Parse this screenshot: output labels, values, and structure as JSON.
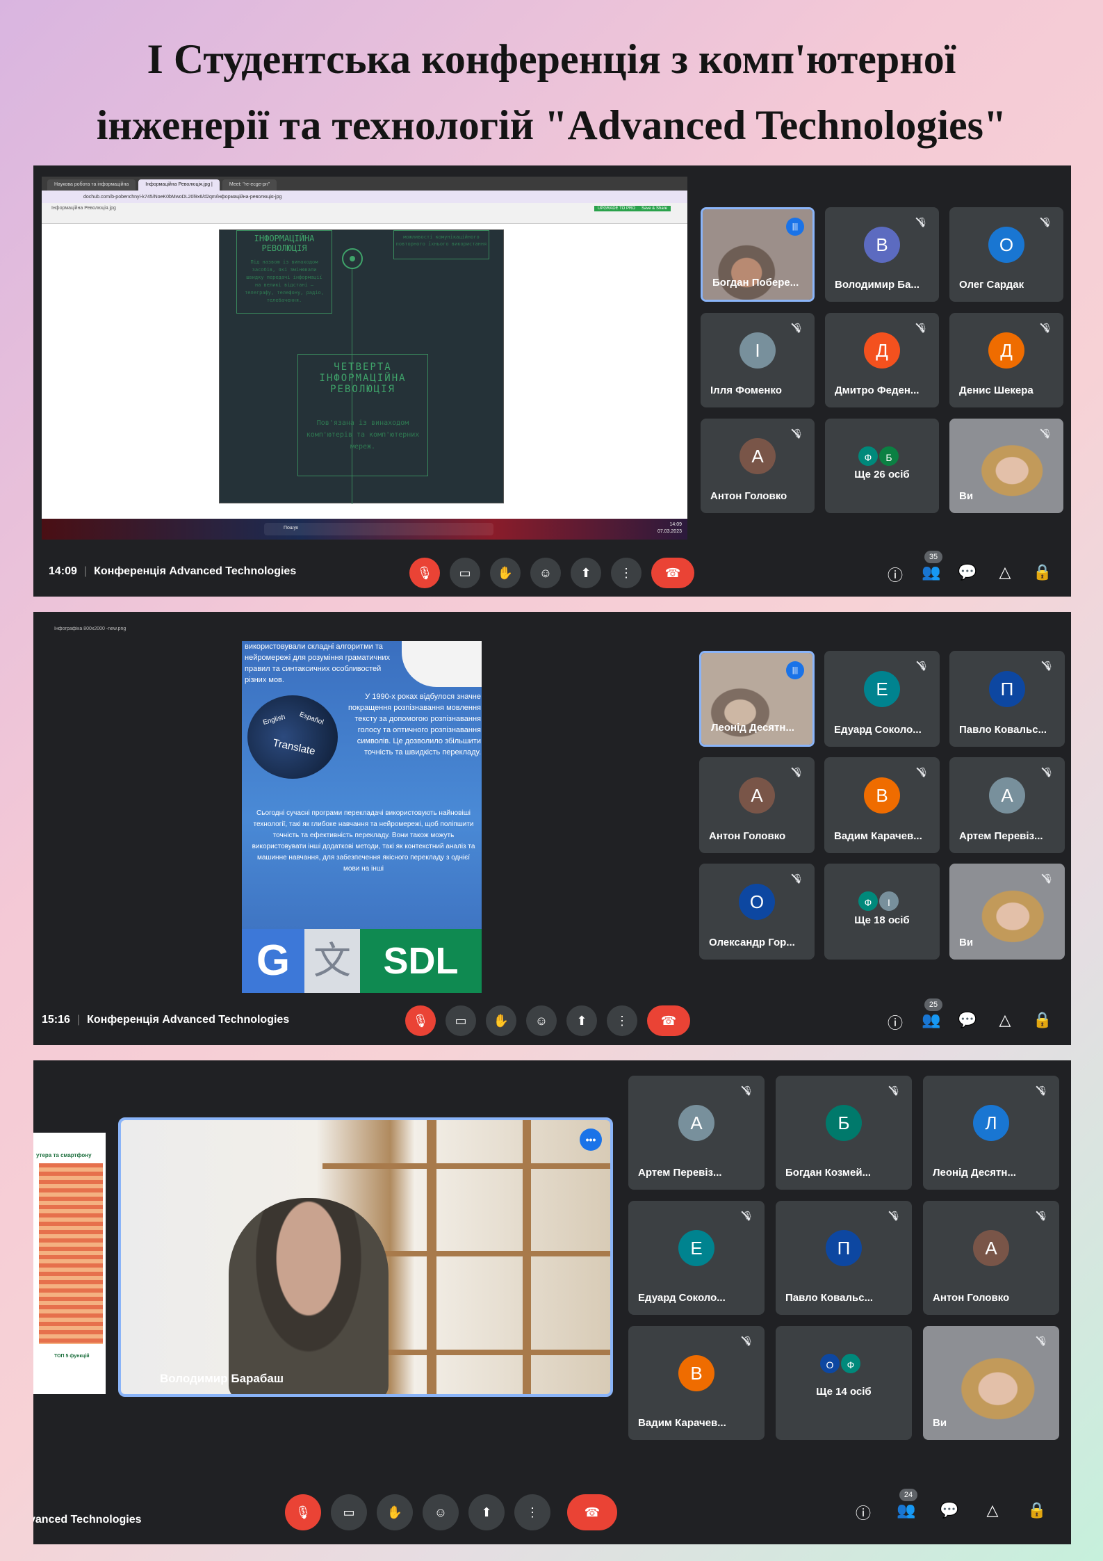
{
  "page": {
    "title_line1": "I Студентська конференція з комп'ютерної",
    "title_line2": "інженерії та технологій \"Advanced Technologies\""
  },
  "colors": {
    "meet_bg": "#202124",
    "tile_bg": "#3c4043",
    "accent": "#8ab4f8",
    "danger": "#ea4335"
  },
  "shot1": {
    "time": "14:09",
    "meeting_title": "Конференція Advanced Technologies",
    "people_count": "35",
    "share": {
      "tabs": [
        "Наукова робота та інформаційна",
        "Інформаційна Революція.jpg | ",
        "Meet: \"re-ecge-pn\""
      ],
      "url": "dochub.com/b-pobenchnyi-k745/NoeK0bMwoDL20l9x6/d2qm/інформаційна-революція-jpg",
      "doc_name": "Інформаційна Революція.jpg",
      "upgrade": "UPGRADE TO PRO",
      "save": "Save & Share",
      "box1_title": "ІНФОРМАЦІЙНА РЕВОЛЮЦІЯ",
      "box1_text": "Під назвою із винаходом засобів, які змінювали швидку передачі інформації на великі відстані – телеграфу, телефону, радіо, телебачення.",
      "box2_text": "можливості комунікаційного повторного їхнього використання",
      "box3_title": "ЧЕТВЕРТА ІНФОРМАЦІЙНА РЕВОЛЮЦІЯ",
      "box3_text": "Пов'язана із винаходом комп'ютерів та комп'ютерних мереж.",
      "taskbar_search": "Пошук",
      "taskbar_time": "14:09",
      "taskbar_date": "07.03.2023"
    },
    "tiles": [
      {
        "name": "Богдан Побере...",
        "type": "photo",
        "speaking": true
      },
      {
        "name": "Володимир Ба...",
        "letter": "В",
        "color": "#5c6bc0"
      },
      {
        "name": "Олег Сардак",
        "letter": "О",
        "color": "#1976d2"
      },
      {
        "name": "Ілля Фоменко",
        "letter": "І",
        "color": "#78909c"
      },
      {
        "name": "Дмитро Феден...",
        "letter": "Д",
        "color": "#f4511e"
      },
      {
        "name": "Денис Шекера",
        "letter": "Д",
        "color": "#ef6c00"
      },
      {
        "name": "Антон Головко",
        "letter": "А",
        "color": "#795548"
      },
      {
        "name": "Ще 26 осіб",
        "dots": [
          "Ф",
          "Б"
        ],
        "dot_colors": [
          "#00897b",
          "#0b8043"
        ]
      },
      {
        "name": "Ви",
        "type": "photo"
      }
    ]
  },
  "shot2": {
    "time": "15:16",
    "meeting_title": "Конференція Advanced Technologies",
    "people_count": "25",
    "share": {
      "viewer_title": "Інфографіка 800х2000 -new.png",
      "p1": "використовували складні алгоритми та нейромережі для розуміння граматичних правил та синтаксичних особливостей різних мов.",
      "p2": "У 1990-х роках відбулося значне покращення розпізнавання мовлення тексту за допомогою розпізнавання голосу та оптичного розпізнавання символів. Це дозволило збільшити точність та швидкість перекладу.",
      "p3": "Сьогодні сучасні програми перекладачі використовують найновіші технології, такі як глибоке навчання та нейромережі, щоб поліпшити точність та ефективність перекладу. Вони також можуть використовувати інші додаткові методи, такі як контекстний аналіз та машинне навчання, для забезпечення якісного перекладу з однієї мови на інші",
      "keys": [
        "English",
        "Español",
        "Translate"
      ],
      "logo_g": "G",
      "logo_t": "文",
      "logo_sdl": "SDL"
    },
    "tiles": [
      {
        "name": "Леонід Десятн...",
        "type": "photo",
        "speaking": true
      },
      {
        "name": "Едуард Соколо...",
        "letter": "Е",
        "color": "#00838f"
      },
      {
        "name": "Павло Ковальс...",
        "letter": "П",
        "color": "#0d47a1"
      },
      {
        "name": "Антон Головко",
        "letter": "А",
        "color": "#795548"
      },
      {
        "name": "Вадим Карачев...",
        "letter": "В",
        "color": "#ef6c00"
      },
      {
        "name": "Артем Перевіз...",
        "letter": "А",
        "color": "#78909c"
      },
      {
        "name": "Олександр Гор...",
        "letter": "О",
        "color": "#0d47a1"
      },
      {
        "name": "Ще 18 осіб",
        "dots": [
          "Ф",
          "І"
        ],
        "dot_colors": [
          "#00897b",
          "#78909c"
        ]
      },
      {
        "name": "Ви",
        "type": "photo"
      }
    ]
  },
  "shot3": {
    "meeting_title": "vanced Technologies",
    "people_count": "24",
    "main_speaker": "Володимир Барабаш",
    "side_doc_title": "утера та смартфону",
    "side_doc_sub": "ТОП 5 функцій",
    "tiles": [
      {
        "name": "Артем Перевіз...",
        "letter": "А",
        "color": "#78909c"
      },
      {
        "name": "Богдан Козмей...",
        "letter": "Б",
        "color": "#00796b"
      },
      {
        "name": "Леонід Десятн...",
        "letter": "Л",
        "color": "#1976d2"
      },
      {
        "name": "Едуард Соколо...",
        "letter": "Е",
        "color": "#00838f"
      },
      {
        "name": "Павло Ковальс...",
        "letter": "П",
        "color": "#0d47a1"
      },
      {
        "name": "Антон Головко",
        "letter": "А",
        "color": "#795548"
      },
      {
        "name": "Вадим Карачев...",
        "letter": "В",
        "color": "#ef6c00"
      },
      {
        "name": "Ще 14 осіб",
        "dots": [
          "О",
          "Ф"
        ],
        "dot_colors": [
          "#0d47a1",
          "#00897b"
        ]
      },
      {
        "name": "Ви",
        "type": "photo"
      }
    ]
  }
}
